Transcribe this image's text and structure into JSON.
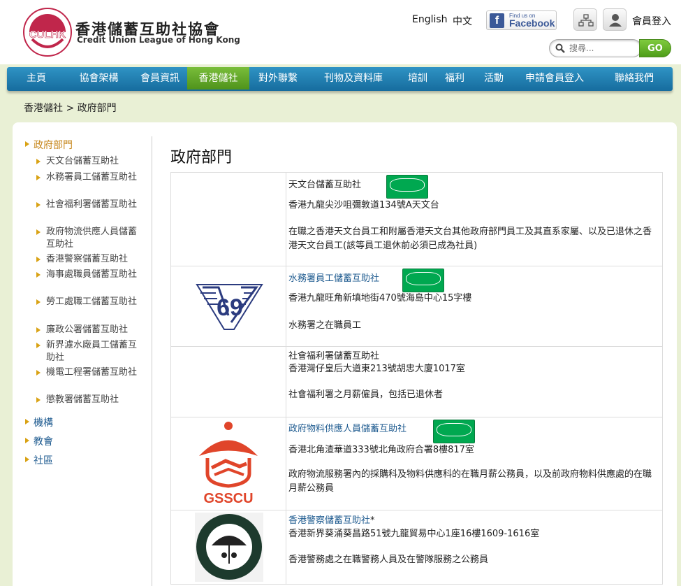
{
  "header": {
    "title_cn": "香港儲蓄互助社協會",
    "title_en": "Credit Union League of Hong Kong",
    "logo_letters": "CULHK",
    "lang_en": "English",
    "lang_cn": "中文",
    "fb_small": "Find us on",
    "fb_big": "Facebook",
    "member_login": "會員登入",
    "search_placeholder": "搜尋...",
    "go_label": "GO",
    "icons": [
      "sitemap-icon",
      "user-icon",
      "search-icon"
    ]
  },
  "nav": {
    "items": [
      "主頁",
      "協會架構",
      "會員資訊",
      "香港儲社",
      "對外聯繫",
      "刊物及資料庫",
      "培訓",
      "福利",
      "活動",
      "申請會員登入",
      "聯絡我們"
    ],
    "active_index": 3
  },
  "breadcrumb": "香港儲社 > 政府部門",
  "sidebar": {
    "current": "政府部門",
    "sub_items": [
      "天文台儲蓄互助社",
      "水務署員工儲蓄互助社",
      "社會福利署儲蓄互助社",
      "政府物流供應人員儲蓄互助社",
      "香港警察儲蓄互助社",
      "海事處職員儲蓄互助社",
      "勞工處職工儲蓄互助社",
      "廉政公署儲蓄互助社",
      "新界濾水廠員工儲蓄互助社",
      "機電工程署儲蓄互助社",
      "懲教署儲蓄互助社"
    ],
    "sections": [
      "機構",
      "教會",
      "社區"
    ]
  },
  "main": {
    "title": "政府部門",
    "rows": [
      {
        "name": "天文台儲蓄互助社",
        "address": "香港九龍尖沙咀彌敦道134號A天文台",
        "desc": "在職之香港天文台員工和附屬香港天文台其他政府部門員工及其直系家屬、以及已退休之香港天文台員工(該等員工退休前必須已成為社員)",
        "link": false,
        "qg": true
      },
      {
        "name": "水務署員工儲蓄互助社",
        "address": "香港九龍旺角新填地街470號海島中心15字樓",
        "desc": "水務署之在職員工",
        "link": true,
        "qg": true
      },
      {
        "name": "社會福利署儲蓄互助社",
        "address": "香港灣仔皇后大道東213號胡忠大廈1017室",
        "desc": "社會福利署之月薪僱員，包括已退休者",
        "link": false,
        "qg": false
      },
      {
        "name": "政府物料供應人員儲蓄互助社",
        "address": "香港北角渣華道333號北角政府合署8樓817室",
        "desc": "政府物流服務署內的採購科及物料供應科的在職月薪公務員，以及前政府物料供應處的在職月薪公務員",
        "link": true,
        "qg": true,
        "logo_text": "GSSCU"
      },
      {
        "name": "香港警察儲蓄互助社",
        "name_suffix": "*",
        "address": "香港新界葵涌葵昌路51號九龍貿易中心1座16樓1609-1616室",
        "desc": "香港警務處之在職警務人員及在警隊服務之公務員",
        "link": true,
        "qg": false
      }
    ]
  },
  "colors": {
    "nav_blue": "#1f7fb3",
    "nav_active_green": "#5fa526",
    "link_blue": "#1d5a8f",
    "sidebar_active": "#c6861a",
    "sidebar_section": "#1d5a8f",
    "qg_green": "#00a850",
    "page_bg": "#e9f0d5"
  }
}
